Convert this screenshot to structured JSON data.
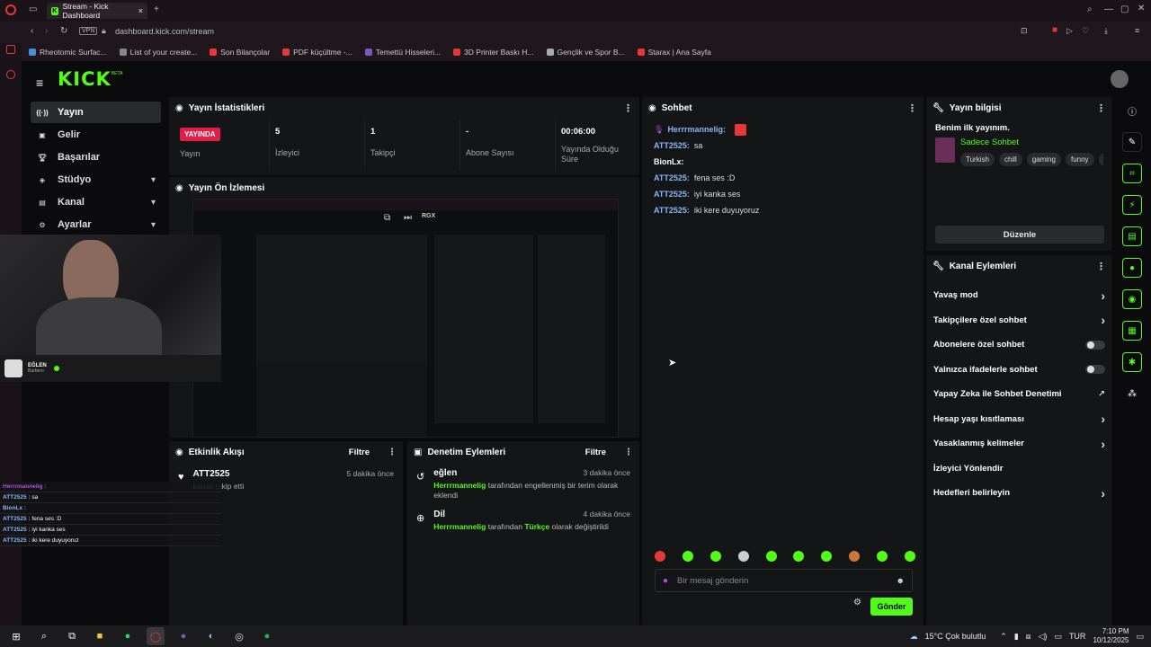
{
  "browser": {
    "tab_title": "Stream - Kick Dashboard",
    "url": "dashboard.kick.com/stream",
    "vpn": "VPN",
    "bookmarks": [
      {
        "label": "Rheotomic Surfac...",
        "color": "#4a90d9"
      },
      {
        "label": "List of your create...",
        "color": "#888"
      },
      {
        "label": "Son Bilançolar",
        "color": "#e53935"
      },
      {
        "label": "PDF küçültme -...",
        "color": "#e53935"
      },
      {
        "label": "Temettü Hisseleri...",
        "color": "#7e57c2"
      },
      {
        "label": "3D Printer Baskı H...",
        "color": "#e53935"
      },
      {
        "label": "Gençlik ve Spor B...",
        "color": "#aaa"
      },
      {
        "label": "Starax | Ana Sayfa",
        "color": "#e53935"
      }
    ]
  },
  "brand": {
    "logo": "KICK",
    "beta": "BETA"
  },
  "sidebar": {
    "items": [
      {
        "label": "Yayın",
        "icon": "broadcast-icon",
        "active": true
      },
      {
        "label": "Gelir",
        "icon": "wallet-icon"
      },
      {
        "label": "Başarılar",
        "icon": "trophy-icon"
      },
      {
        "label": "Stüdyo",
        "icon": "studio-icon",
        "chev": "▾"
      },
      {
        "label": "Kanal",
        "icon": "channel-icon",
        "chev": "▾"
      },
      {
        "label": "Ayarlar",
        "icon": "gear-icon",
        "chev": "▾"
      }
    ]
  },
  "stats": {
    "title": "Yayın İstatistikleri",
    "live_badge": "YAYINDA",
    "status_label": "Yayın",
    "viewers": {
      "value": "5",
      "label": "İzleyici"
    },
    "followers": {
      "value": "1",
      "label": "Takipçi"
    },
    "subs": {
      "value": "-",
      "label": "Abone Sayısı"
    },
    "uptime": {
      "value": "00:06:00",
      "label": "Yayında Olduğu Süre"
    }
  },
  "preview": {
    "title": "Yayın Ön İzlemesi",
    "rgx": "RGX"
  },
  "overlay": {
    "streamer_name": "EĞLEN",
    "streamer_sub": "Barbero",
    "chat": [
      {
        "user": "Herrrmannelig :",
        "text": ""
      },
      {
        "user": "ATT2525 :",
        "text": " sa"
      },
      {
        "user": "BionLx :",
        "text": ""
      },
      {
        "user": "ATT2525 :",
        "text": " fena ses :D"
      },
      {
        "user": "ATT2525 :",
        "text": " iyi kanka ses"
      },
      {
        "user": "ATT2525 :",
        "text": " iki kere duyuyoruz"
      }
    ]
  },
  "activity": {
    "title": "Etkinlik Akışı",
    "filter": "Filtre",
    "items": [
      {
        "user": "ATT2525",
        "text": "kanalı takip etti",
        "time": "5 dakika önce"
      }
    ]
  },
  "moderation": {
    "title": "Denetim Eylemleri",
    "filter": "Filtre",
    "items": [
      {
        "title": "eğlen",
        "user": "Herrrmannelig",
        "mid": "tarafından engellenmiş bir terim olarak eklendi",
        "highlight": "",
        "tail": "",
        "time": "3 dakika önce"
      },
      {
        "title": "Dil",
        "user": "Herrrmannelig",
        "mid": "tarafından",
        "highlight": "Türkçe",
        "tail": "olarak değiştirildi",
        "time": "4 dakika önce"
      }
    ]
  },
  "chat": {
    "title": "Sohbet",
    "messages": [
      {
        "user": "Herrrmannelig:",
        "text": ""
      },
      {
        "user": "ATT2525:",
        "text": "sa"
      },
      {
        "user": "BionLx:",
        "text": ""
      },
      {
        "user": "ATT2525:",
        "text": "fena ses :D"
      },
      {
        "user": "ATT2525:",
        "text": "iyi kanka ses"
      },
      {
        "user": "ATT2525:",
        "text": "iki kere duyuyoruz"
      }
    ],
    "placeholder": "Bir mesaj gönderin",
    "send": "Gönder"
  },
  "stream_info": {
    "title": "Yayın bilgisi",
    "stream_title": "Benim ilk yayınım.",
    "category": "Sadece Sohbet",
    "tags": [
      "Turkish",
      "chill",
      "gaming",
      "funny",
      "Tü"
    ],
    "edit": "Düzenle"
  },
  "channel_actions": {
    "title": "Kanal Eylemleri",
    "items": [
      {
        "label": "Yavaş mod",
        "kind": "chevron"
      },
      {
        "label": "Takipçilere özel sohbet",
        "kind": "chevron"
      },
      {
        "label": "Abonelere özel sohbet",
        "kind": "toggle"
      },
      {
        "label": "Yalnızca ifadelerle sohbet",
        "kind": "toggle"
      },
      {
        "label": "Yapay Zeka ile Sohbet Denetimi",
        "kind": "external"
      },
      {
        "label": "Hesap yaşı kısıtlaması",
        "kind": "chevron"
      },
      {
        "label": "Yasaklanmış kelimeler",
        "kind": "chevron"
      },
      {
        "label": "İzleyici Yönlendir",
        "kind": "none"
      },
      {
        "label": "Hedefleri belirleyin",
        "kind": "chevron"
      }
    ]
  },
  "taskbar": {
    "weather": "15°C  Çok bulutlu",
    "lang": "TUR",
    "time": "7:10 PM",
    "date": "10/12/2025"
  },
  "colors": {
    "accent": "#53fc18",
    "live": "#e11d48",
    "user": "#8ab4f8"
  }
}
